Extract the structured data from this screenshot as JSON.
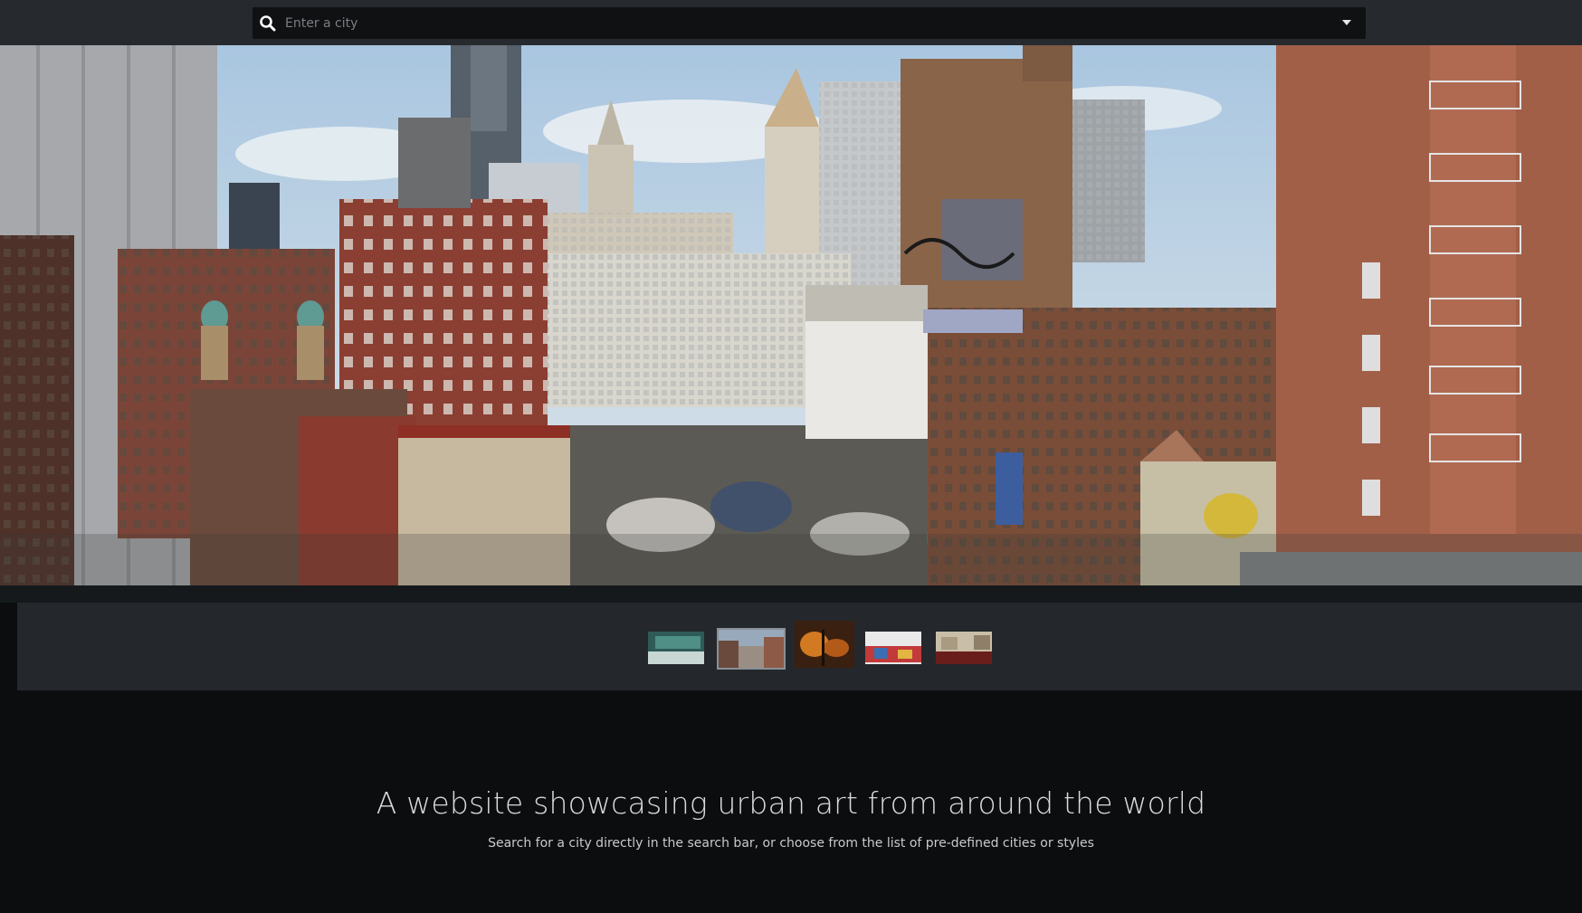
{
  "search": {
    "placeholder": "Enter a city",
    "icon": "search-icon",
    "dropdown_icon": "caret-down-icon"
  },
  "hero": {
    "image_subject": "city skyline with graffiti-covered rooftops"
  },
  "thumbnails": [
    {
      "subject": "teal graffiti wall",
      "active": false
    },
    {
      "subject": "city rooftops with graffiti",
      "active": true
    },
    {
      "subject": "night street scene",
      "active": false
    },
    {
      "subject": "colorful mural street",
      "active": false
    },
    {
      "subject": "street with red graffiti",
      "active": false
    }
  ],
  "intro": {
    "heading": "A website showcasing urban art from around the world",
    "subheading": "Search for a city directly in the search bar, or choose from the list of pre-defined cities or styles"
  },
  "colors": {
    "background": "#0b0d0f",
    "topbar": "#262a2e",
    "thumb_strip": "#24282c"
  }
}
